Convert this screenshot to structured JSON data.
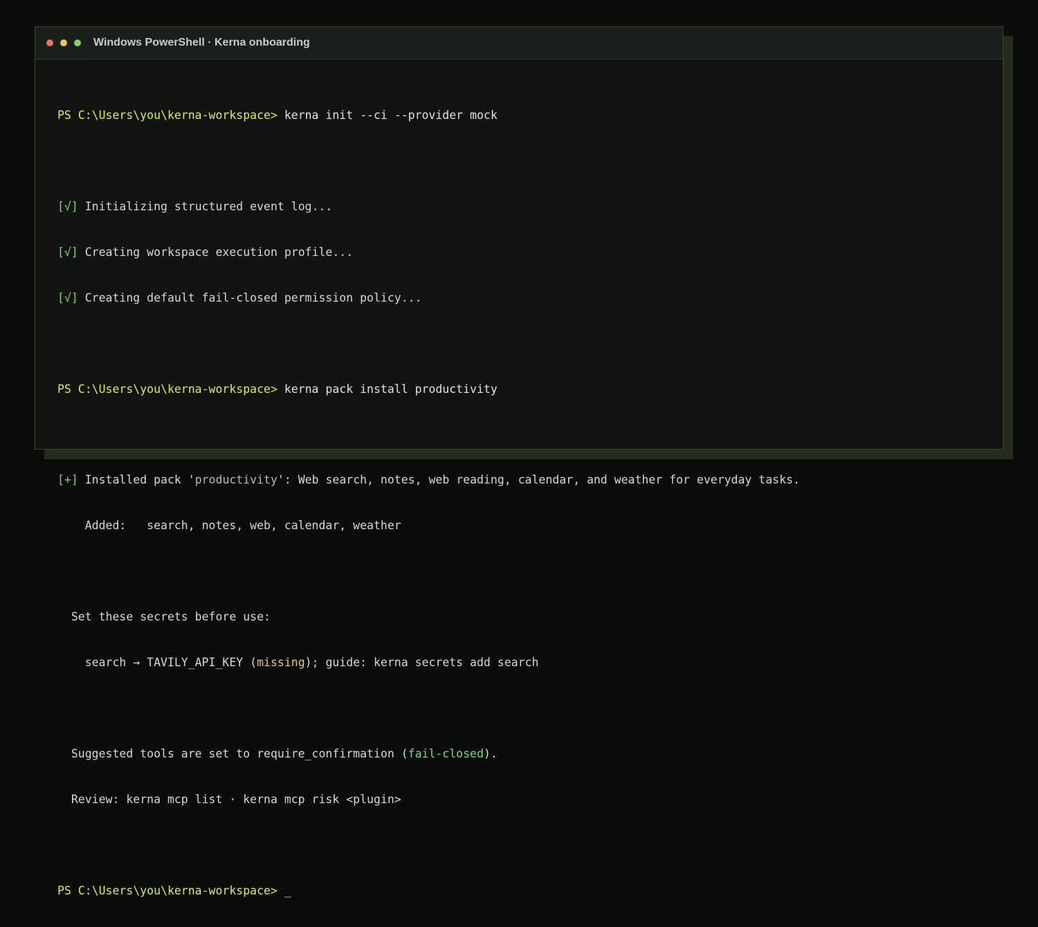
{
  "window": {
    "title": "Windows PowerShell · Kerna onboarding"
  },
  "terminal": {
    "prompt": "PS C:\\Users\\you\\kerna-workspace>",
    "cmd1": " kerna init --ci --provider mock",
    "check_mark": "[√]",
    "init_lines": [
      " Initializing structured event log...",
      " Creating workspace execution profile...",
      " Creating default fail-closed permission policy..."
    ],
    "cmd2": " kerna pack install productivity",
    "plus_mark": "[+]",
    "installed_prefix": " Installed pack '",
    "pack_name": "productivity",
    "installed_suffix": "': Web search, notes, web reading, calendar, and weather for everyday tasks.",
    "added_line": "    Added:   search, notes, web, calendar, weather",
    "secrets_header": "  Set these secrets before use:",
    "secret_prefix": "    search → TAVILY_API_KEY (",
    "secret_status": "missing",
    "secret_suffix": "); guide: kerna secrets add search",
    "suggested_prefix": "  Suggested tools are set to require_confirmation (",
    "suggested_policy": "fail-closed",
    "suggested_suffix": ").",
    "review_line": "  Review: kerna mcp list · kerna mcp risk <plugin>",
    "cursor": " _"
  }
}
